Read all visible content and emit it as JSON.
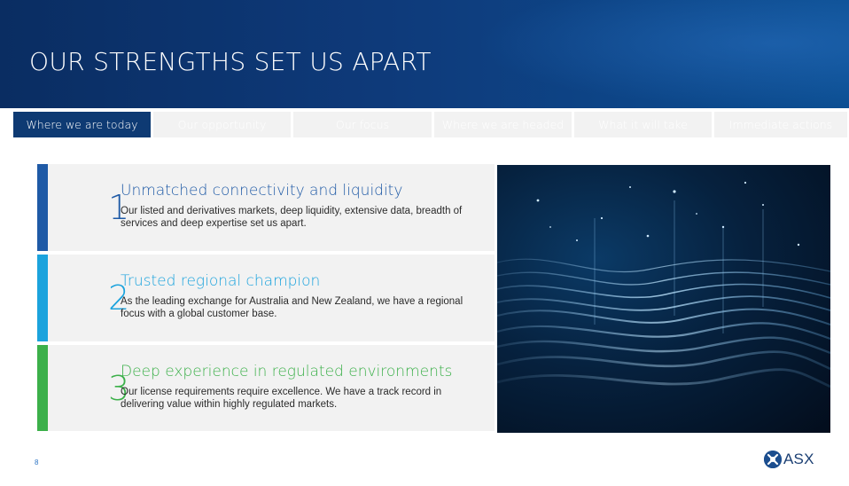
{
  "slide": {
    "title": "OUR STRENGTHS SET US APART",
    "page_number": "8"
  },
  "tabs": [
    {
      "label": "Where we are today",
      "active": true
    },
    {
      "label": "Our opportunity",
      "active": false
    },
    {
      "label": "Our focus",
      "active": false
    },
    {
      "label": "Where we are headed",
      "active": false
    },
    {
      "label": "What it will take",
      "active": false
    },
    {
      "label": "Immediate actions",
      "active": false
    }
  ],
  "strengths": [
    {
      "number": "1",
      "title": "Unmatched connectivity and liquidity",
      "description": "Our listed and derivatives markets, deep liquidity, extensive data, breadth of services and deep expertise set us apart.",
      "color": "#1f5aa6"
    },
    {
      "number": "2",
      "title": "Trusted regional champion",
      "description": "As the leading exchange for Australia and New Zealand, we have a regional focus with a global customer base.",
      "color": "#1ba3dd"
    },
    {
      "number": "3",
      "title": "Deep experience in regulated environments",
      "description": "Our license requirements require excellence. We have a track record in delivering value within highly regulated markets.",
      "color": "#3cb04a"
    }
  ],
  "logo": {
    "text": "ASX",
    "icon": "asx-logo-icon"
  },
  "colors": {
    "header": "#0e3a73",
    "active_tab": "#0e3a73",
    "card_background": "#f2f2f2"
  }
}
